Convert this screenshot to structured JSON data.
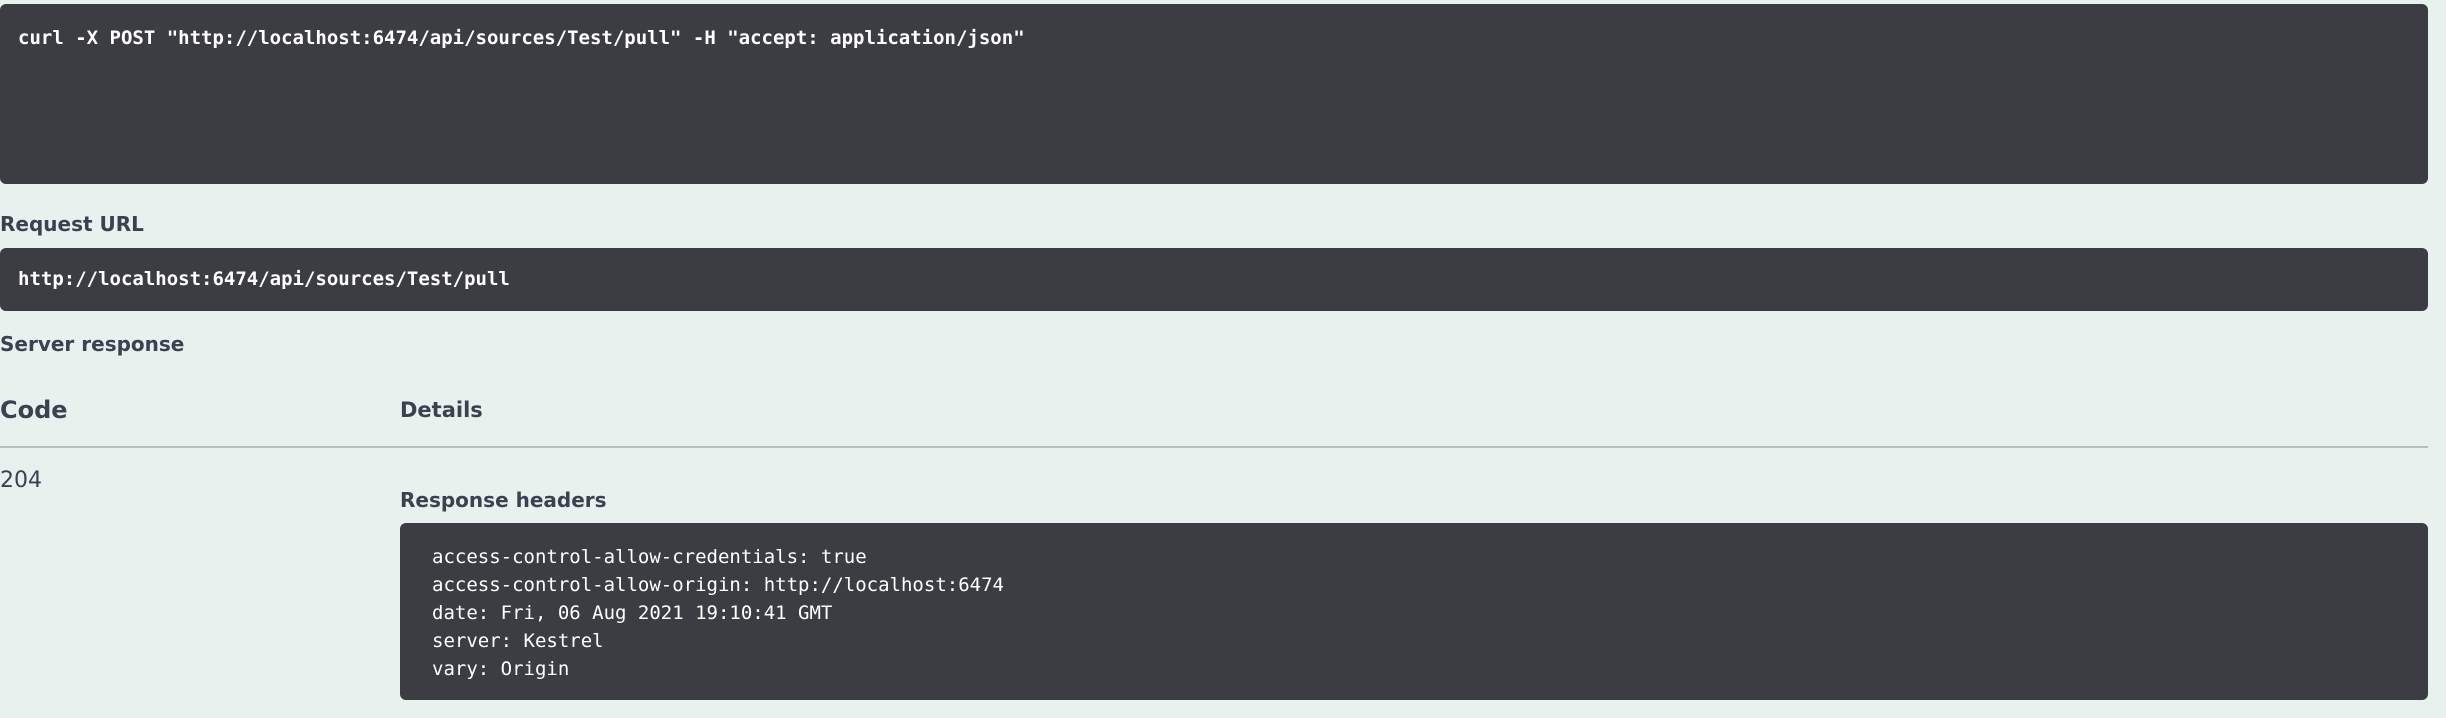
{
  "curl": {
    "command": "curl -X POST \"http://localhost:6474/api/sources/Test/pull\" -H \"accept: application/json\""
  },
  "request_url": {
    "label": "Request URL",
    "value": "http://localhost:6474/api/sources/Test/pull"
  },
  "server_response": {
    "label": "Server response",
    "columns": {
      "code": "Code",
      "details": "Details"
    },
    "status_code": "204",
    "response_headers_label": "Response headers",
    "headers": [
      "access-control-allow-credentials: true",
      "access-control-allow-origin: http://localhost:6474",
      "date: Fri, 06 Aug 2021 19:10:41 GMT",
      "server: Kestrel",
      "vary: Origin"
    ]
  },
  "colors": {
    "background": "#e8f1ee",
    "code_block": "#3b3d42",
    "text": "#3b4151"
  }
}
